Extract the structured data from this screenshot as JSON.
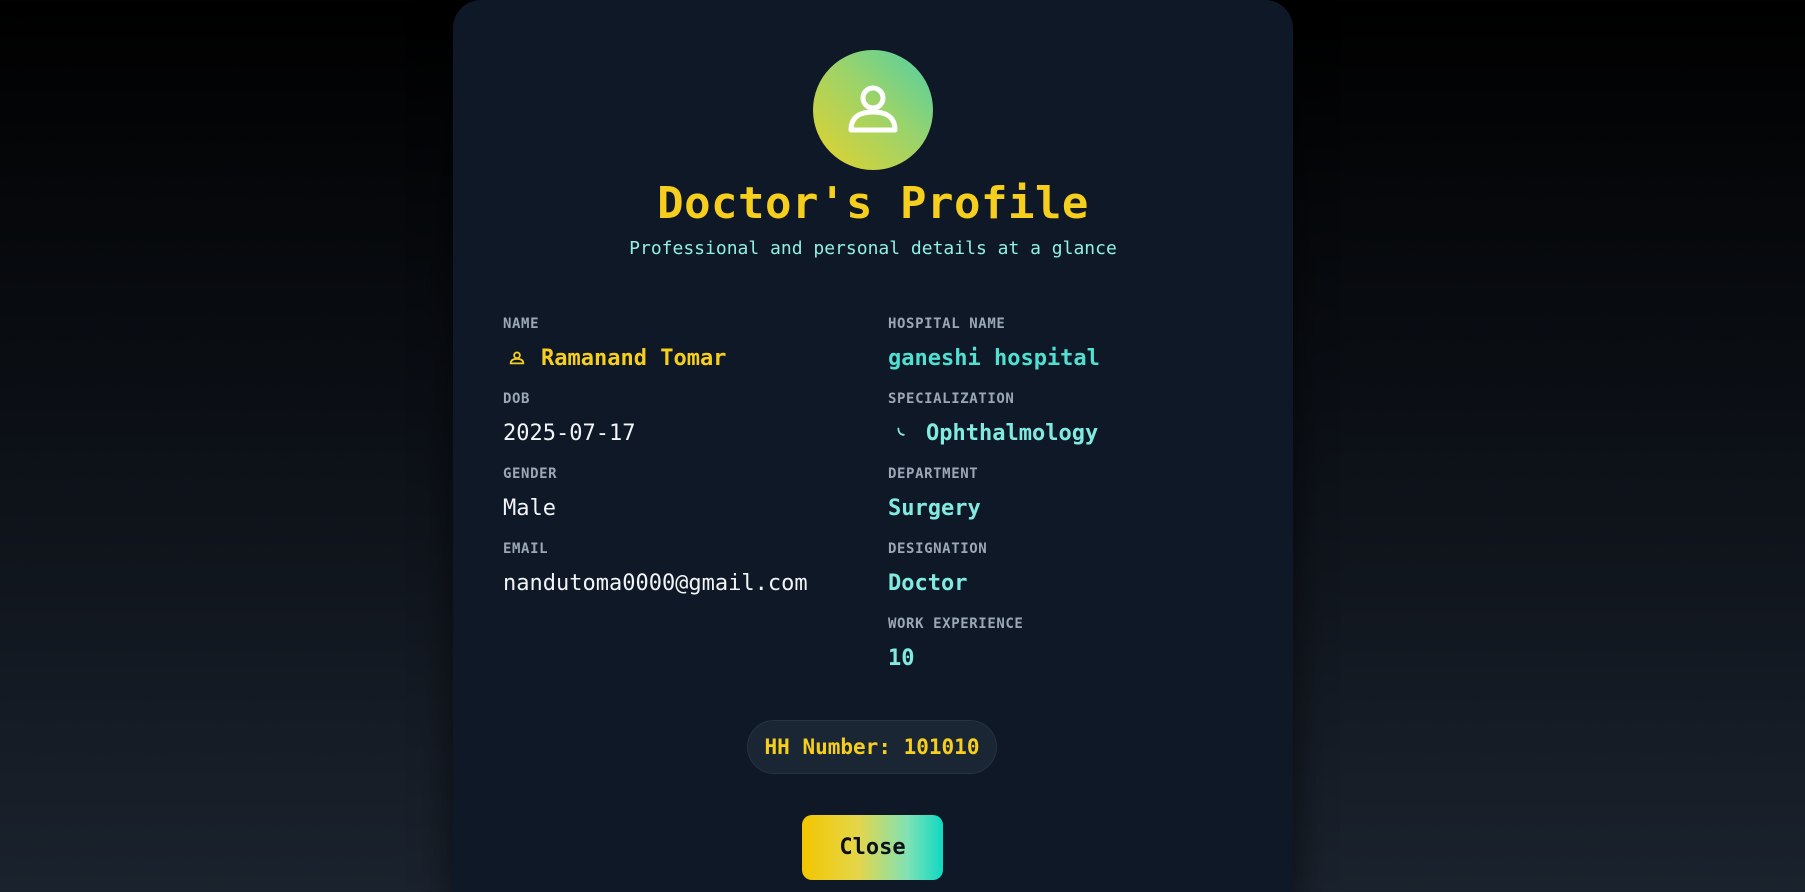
{
  "profile": {
    "title": "Doctor's Profile",
    "subtitle": "Professional and personal details at a glance",
    "avatar_icon": "user-icon",
    "left_fields": [
      {
        "label": "NAME",
        "value": "Ramanand Tomar",
        "icon": "user-icon"
      },
      {
        "label": "DOB",
        "value": "2025-07-17"
      },
      {
        "label": "GENDER",
        "value": "Male"
      },
      {
        "label": "EMAIL",
        "value": "nandutoma0000@gmail.com"
      }
    ],
    "right_fields": [
      {
        "label": "HOSPITAL NAME",
        "value": "ganeshi hospital"
      },
      {
        "label": "SPECIALIZATION",
        "value": "Ophthalmology",
        "icon": "stethoscope-icon"
      },
      {
        "label": "DEPARTMENT",
        "value": "Surgery"
      },
      {
        "label": "DESIGNATION",
        "value": "Doctor"
      },
      {
        "label": "WORK EXPERIENCE",
        "value": "10"
      }
    ],
    "hh_number": "HH Number: 101010",
    "close_label": "Close"
  },
  "colors": {
    "accent_yellow": "#f6cf1e",
    "accent_cyan": "#82ebe1",
    "card_background": "#0f1826"
  }
}
